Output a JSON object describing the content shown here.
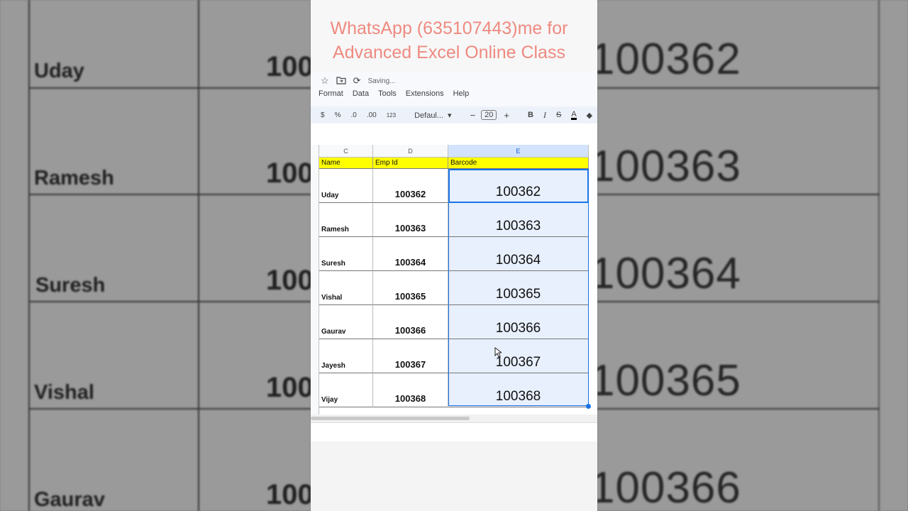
{
  "banner": {
    "line1": "WhatsApp (635107443)me for",
    "line2": "Advanced Excel Online Class"
  },
  "top_bar": {
    "saving_text": "Saving...",
    "icons": [
      "star-icon",
      "move-to-folder-icon",
      "sync-icon"
    ]
  },
  "menus": [
    "Format",
    "Data",
    "Tools",
    "Extensions",
    "Help"
  ],
  "toolbar": {
    "currency": "$",
    "percent": "%",
    "dec_decrease": ".0",
    "dec_increase": ".00",
    "number_format": "123",
    "font": "Defaul...",
    "minus": "−",
    "font_size": "20",
    "plus": "+",
    "bold": "B",
    "italic": "I",
    "strike": "S",
    "text_color": "A"
  },
  "columns": [
    "C",
    "D",
    "E"
  ],
  "header_row": [
    "Name",
    "Emp Id",
    "Barcode"
  ],
  "rows": [
    {
      "name": "Uday",
      "id": "100362",
      "barcode": "100362"
    },
    {
      "name": "Ramesh",
      "id": "100363",
      "barcode": "100363"
    },
    {
      "name": "Suresh",
      "id": "100364",
      "barcode": "100364"
    },
    {
      "name": "Vishal",
      "id": "100365",
      "barcode": "100365"
    },
    {
      "name": "Gaurav",
      "id": "100366",
      "barcode": "100366"
    },
    {
      "name": "Jayesh",
      "id": "100367",
      "barcode": "100367"
    },
    {
      "name": "Vijay",
      "id": "100368",
      "barcode": "100368"
    }
  ],
  "bg_left": {
    "names": [
      "Uday",
      "Ramesh",
      "Suresh",
      "Vishal",
      "Gaurav"
    ],
    "partial_id": "100"
  },
  "bg_right": {
    "codes": [
      "100362",
      "100363",
      "100364",
      "100365",
      "100366"
    ]
  },
  "colors": {
    "header_fill": "#ffff00",
    "selection": "#1a73e8",
    "banner_text": "#ef8a80"
  }
}
